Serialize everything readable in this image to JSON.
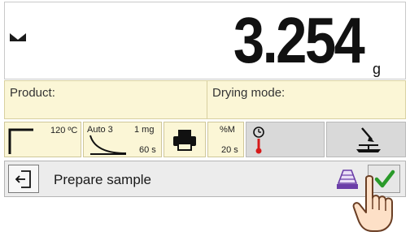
{
  "display": {
    "mass_value": "3.254",
    "unit": "g",
    "stability_indicator": "stable-weight-icon"
  },
  "info_bar": {
    "product_label": "Product:",
    "drying_mode_label": "Drying mode:"
  },
  "params": {
    "drying_profile": {
      "icon": "standard-profile-icon",
      "temperature": "120 ºC"
    },
    "finish_mode": {
      "icon": "auto-finish-curve-icon",
      "mode": "Auto 3",
      "threshold": "1 mg",
      "interval": "60 s"
    },
    "printer": {
      "icon": "printer-icon"
    },
    "print_interval": {
      "value": "%M",
      "interval": "20 s"
    },
    "temperature_timer": {
      "icon": "clock-thermometer-icon"
    },
    "pan_action": {
      "icon": "sample-pan-arrow-icon"
    }
  },
  "action_bar": {
    "exit_icon": "exit-icon",
    "label": "Prepare sample",
    "sample_icon": "sample-pan-icon",
    "confirm_icon": "checkmark-icon"
  },
  "colors": {
    "panel_yellow": "#fbf6d6",
    "tile_gray": "#d9d9d9",
    "confirm_green": "#2a9a2a",
    "thermometer_red": "#d61a1a",
    "sample_purple": "#6b3ea8"
  }
}
